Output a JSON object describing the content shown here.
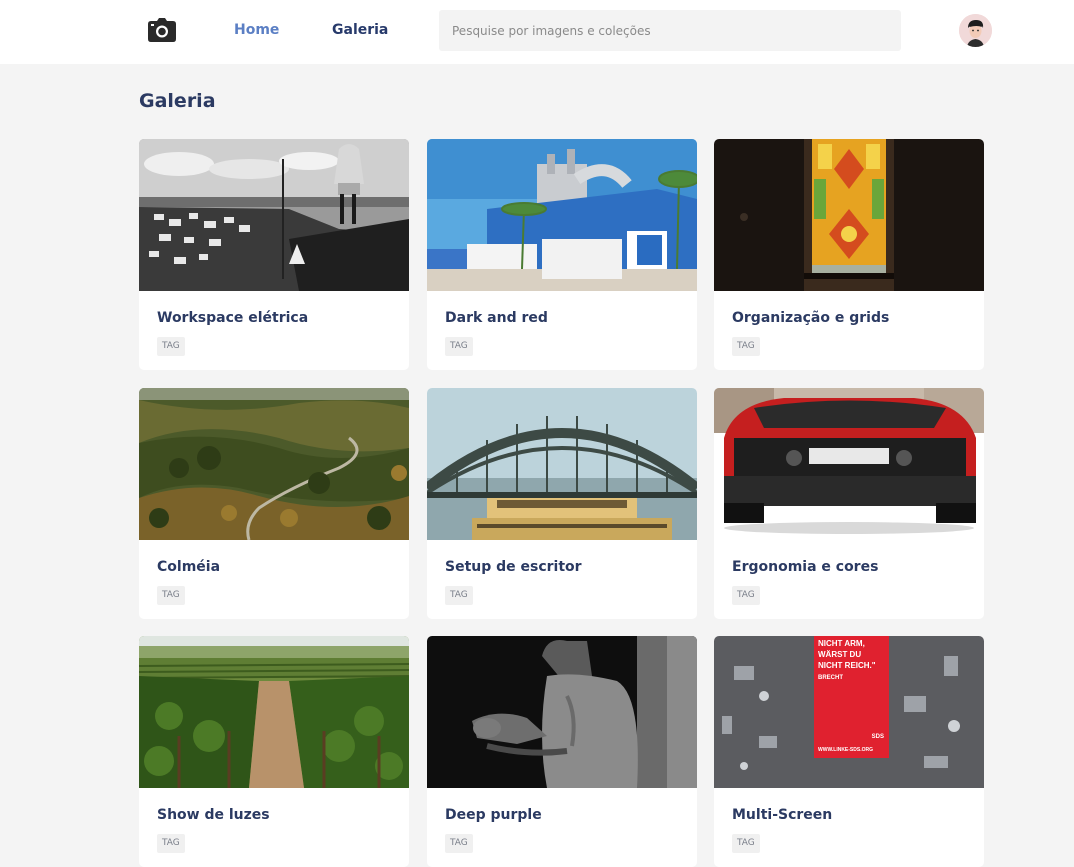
{
  "header": {
    "logo_icon": "camera-icon",
    "nav": [
      {
        "label": "Home",
        "active": true
      },
      {
        "label": "Galeria",
        "active": false
      }
    ],
    "search": {
      "placeholder": "Pesquise por imagens e coleções",
      "value": ""
    },
    "avatar_icon": "user-avatar"
  },
  "main": {
    "title": "Galeria",
    "cards": [
      {
        "title": "Workspace elétrica",
        "tag": "TAG",
        "image": "black-white-coastal-town"
      },
      {
        "title": "Dark and red",
        "tag": "TAG",
        "image": "blue-industrial-building"
      },
      {
        "title": "Organização e grids",
        "tag": "TAG",
        "image": "stained-glass-window"
      },
      {
        "title": "Colméia",
        "tag": "TAG",
        "image": "green-hills-road"
      },
      {
        "title": "Setup de escritor",
        "tag": "TAG",
        "image": "harbour-bridge"
      },
      {
        "title": "Ergonomia e cores",
        "tag": "TAG",
        "image": "red-sports-car"
      },
      {
        "title": "Show de luzes",
        "tag": "TAG",
        "image": "vineyard-rows"
      },
      {
        "title": "Deep purple",
        "tag": "TAG",
        "image": "man-in-shadow"
      },
      {
        "title": "Multi-Screen",
        "tag": "TAG",
        "image": "red-poster-wall"
      }
    ],
    "poster_text": [
      "NICHT ARM,",
      "WÄRST DU",
      "NICHT REICH.\"",
      "BRECHT",
      "SDS",
      "WWW.LINKE-SDS.ORG"
    ]
  },
  "colors": {
    "accent": "#5b7fc4",
    "heading": "#2b3a62",
    "background": "#f4f4f4"
  }
}
